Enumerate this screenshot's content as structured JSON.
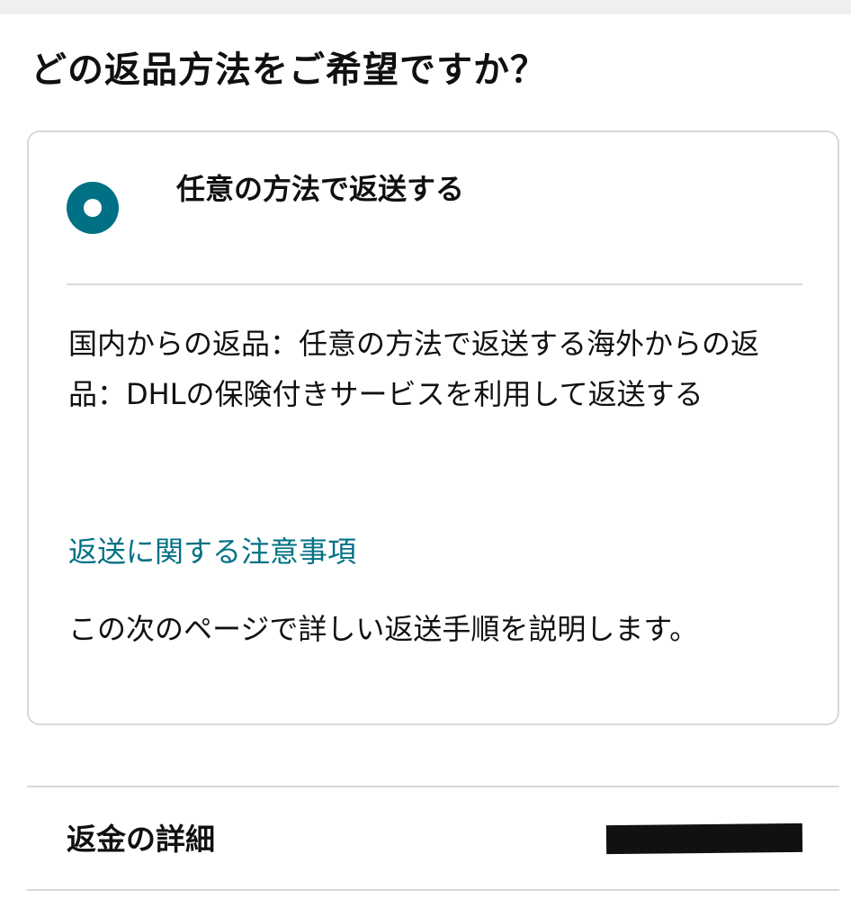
{
  "page": {
    "title": "どの返品方法をご希望ですか？"
  },
  "option": {
    "label": "任意の方法で返送する",
    "selected": true,
    "description": "国内からの返品：任意の方法で返送する海外からの返品：DHLの保険付きサービスを利用して返送する",
    "notes_link": "返送に関する注意事項",
    "next_info": "この次のページで詳しい返送手順を説明します。"
  },
  "refund": {
    "label": "返金の詳細"
  },
  "colors": {
    "accent": "#007185",
    "text": "#0f1111",
    "border": "#d5d9d9",
    "top_strip": "#efefef"
  }
}
